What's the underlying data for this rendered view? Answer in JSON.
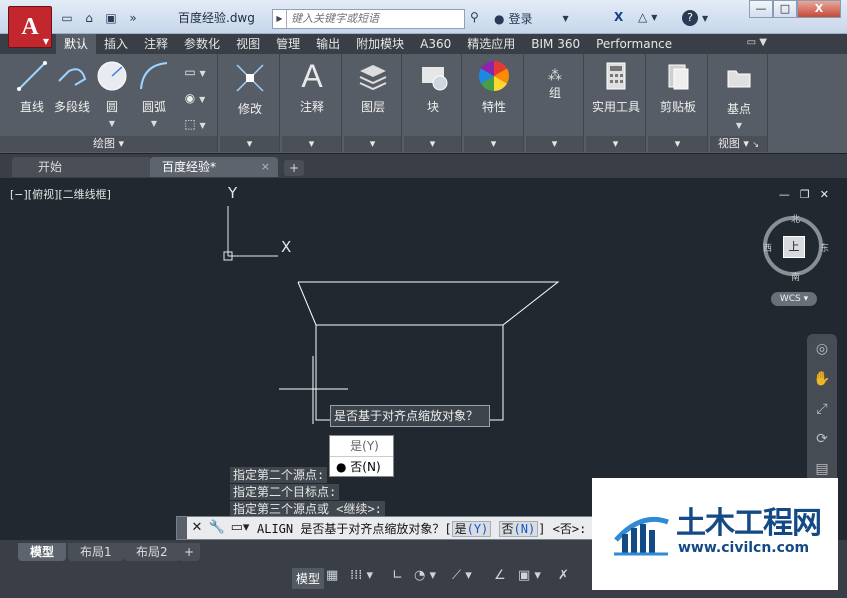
{
  "titlebar": {
    "doc_title": "百度经验.dwg",
    "search_placeholder": "键入关键字或短语",
    "login_label": "登录",
    "help_label": "?",
    "win_min": "—",
    "win_max": "□",
    "win_close": "X"
  },
  "ribbon_tabs": [
    "默认",
    "插入",
    "注释",
    "参数化",
    "视图",
    "管理",
    "输出",
    "附加模块",
    "A360",
    "精选应用",
    "BIM 360",
    "Performance"
  ],
  "ribbon": {
    "draw_tools": {
      "line": "直线",
      "polyline": "多段线",
      "circle": "圆",
      "arc": "圆弧"
    },
    "panels": {
      "draw_footer": "绘图 ▾",
      "modify": "修改",
      "annotate": "注释",
      "layers": "图层",
      "block": "块",
      "properties": "特性",
      "group": "组",
      "utilities": "实用工具",
      "clipboard": "剪贴板",
      "base": "基点",
      "view_footer": "视图 ▾"
    }
  },
  "file_tabs": {
    "start": "开始",
    "current": "百度经验*",
    "close_glyph": "×",
    "add_glyph": "+"
  },
  "viewport": {
    "label": "[−][俯视][二维线框]",
    "ucs_x": "X",
    "ucs_y": "Y",
    "compass": {
      "north": "北",
      "south": "南",
      "east": "东",
      "west": "西",
      "top": "上"
    },
    "wcs": "WCS ▾"
  },
  "dynamic_input": {
    "prompt": "是否基于对齐点缩放对象？",
    "options": [
      "是(Y)",
      "否(N)"
    ],
    "selected_index": 1
  },
  "command_history": [
    "指定第二个源点:",
    "指定第二个目标点:",
    "指定第三个源点或 <继续>:"
  ],
  "command_line": {
    "prefix": "ALIGN 是否基于对齐点缩放对象？[",
    "opt_yes": "是",
    "opt_yes_key": "(Y)",
    "opt_no": "否",
    "opt_no_key": "(N)",
    "suffix": "] <否>:"
  },
  "layout_tabs": [
    "模型",
    "布局1",
    "布局2"
  ],
  "statusbar": {
    "model": "模型"
  },
  "watermark": {
    "cn": "土木工程网",
    "url": "www.civilcn.com"
  }
}
